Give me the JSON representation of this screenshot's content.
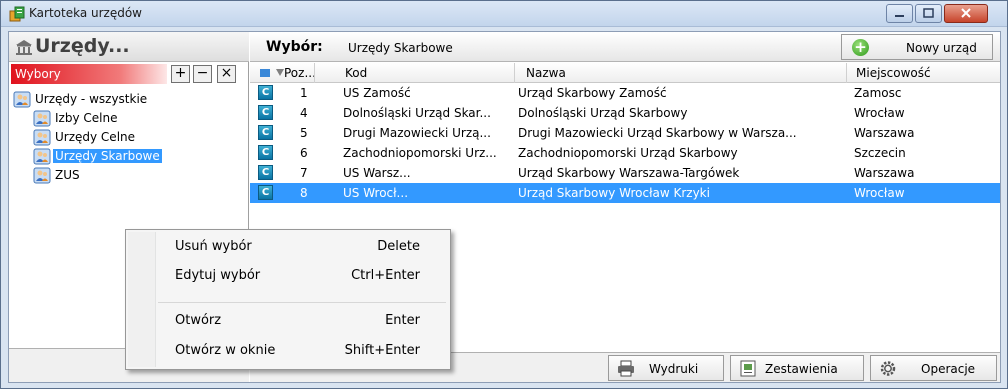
{
  "window": {
    "title": "Kartoteka urzędów"
  },
  "left": {
    "title": "Urzędy...",
    "wybory_label": "Wybory",
    "btn_add": "+",
    "btn_remove": "−",
    "btn_close": "×",
    "tree": [
      {
        "label": "Urzędy - wszystkie"
      },
      {
        "label": "Izby Celne"
      },
      {
        "label": "Urzędy Celne"
      },
      {
        "label": "Urzędy Skarbowe"
      },
      {
        "label": "ZUS"
      }
    ]
  },
  "right": {
    "choice_label": "Wybór:",
    "choice_value": "Urzędy Skarbowe",
    "new_button": "Nowy urząd",
    "columns": {
      "poz": "Poz...",
      "kod": "Kod",
      "nazwa": "Nazwa",
      "miejscowosc": "Miejscowość"
    },
    "rows": [
      {
        "icon": "C",
        "poz": "1",
        "kod": "US Zamość",
        "nazwa": "Urząd Skarbowy Zamość",
        "miejscowosc": "Zamosc"
      },
      {
        "icon": "C",
        "poz": "4",
        "kod": "Dolnośląski Urząd Skar...",
        "nazwa": "Dolnośląski Urząd Skarbowy",
        "miejscowosc": "Wrocław"
      },
      {
        "icon": "C",
        "poz": "5",
        "kod": "Drugi Mazowiecki Urzą...",
        "nazwa": "Drugi Mazowiecki Urząd Skarbowy w Warsza...",
        "miejscowosc": "Warszawa"
      },
      {
        "icon": "C",
        "poz": "6",
        "kod": "Zachodniopomorski Urz...",
        "nazwa": "Zachodniopomorski Urząd Skarbowy",
        "miejscowosc": "Szczecin"
      },
      {
        "icon": "C",
        "poz": "7",
        "kod": "US Warsz...",
        "nazwa": "Urząd Skarbowy Warszawa-Targówek",
        "miejscowosc": "Warszawa"
      },
      {
        "icon": "C",
        "poz": "8",
        "kod": "US Wrocł...",
        "nazwa": "Urząd Skarbowy Wrocław Krzyki",
        "miejscowosc": "Wrocław",
        "selected": true
      }
    ],
    "footer": {
      "wydruki": "Wydruki",
      "zestawienia": "Zestawienia",
      "operacje": "Operacje"
    }
  },
  "context_menu": {
    "items": [
      {
        "label": "Usuń wybór",
        "shortcut": "Delete"
      },
      {
        "label": "Edytuj wybór",
        "shortcut": "Ctrl+Enter"
      },
      {
        "label": "Otwórz",
        "shortcut": "Enter"
      },
      {
        "label": "Otwórz w oknie",
        "shortcut": "Shift+Enter"
      }
    ]
  },
  "colors": {
    "selection": "#3399ff",
    "wybory_red": "#e0121d",
    "accent_green": "#2e9a1b"
  }
}
